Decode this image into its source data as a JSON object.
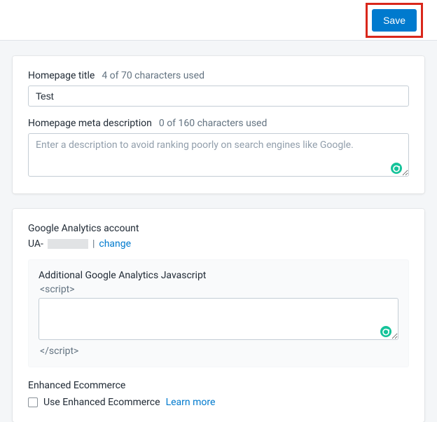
{
  "topbar": {
    "save_label": "Save"
  },
  "seo": {
    "title_label": "Homepage title",
    "title_hint": "4 of 70 characters used",
    "title_value": "Test",
    "meta_label": "Homepage meta description",
    "meta_hint": "0 of 160 characters used",
    "meta_placeholder": "Enter a description to avoid ranking poorly on search engines like Google.",
    "meta_value": ""
  },
  "ga": {
    "heading": "Google Analytics account",
    "prefix": "UA-",
    "pipe": "|",
    "change_label": "change",
    "js_heading": "Additional Google Analytics Javascript",
    "open_tag": "<script>",
    "close_tag": "</script>",
    "js_value": ""
  },
  "ecom": {
    "heading": "Enhanced Ecommerce",
    "checkbox_label": "Use Enhanced Ecommerce",
    "learn_more": "Learn more",
    "checked": false
  }
}
